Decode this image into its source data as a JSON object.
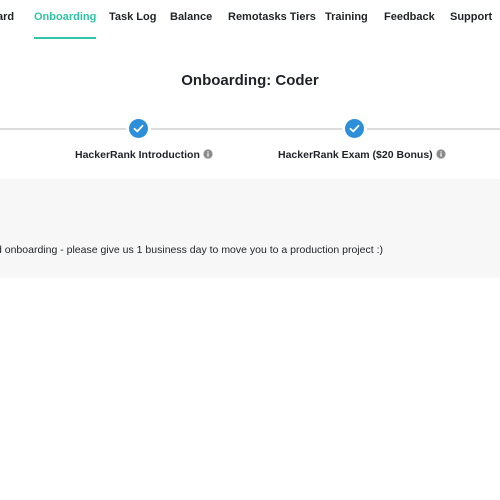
{
  "nav": {
    "items": [
      {
        "label": "ard",
        "active": false
      },
      {
        "label": "Onboarding",
        "active": true
      },
      {
        "label": "Task Log",
        "active": false
      },
      {
        "label": "Balance",
        "active": false
      },
      {
        "label": "Remotasks Tiers",
        "active": false
      },
      {
        "label": "Training",
        "active": false
      },
      {
        "label": "Feedback",
        "active": false
      },
      {
        "label": "Support",
        "active": false
      }
    ]
  },
  "title": "Onboarding: Coder",
  "steps": [
    {
      "label": "HackerRank Introduction",
      "completed": true,
      "icon": "check-icon",
      "info_icon": "info-icon"
    },
    {
      "label": "HackerRank Exam ($20 Bonus)",
      "completed": true,
      "icon": "check-icon",
      "info_icon": "info-icon"
    }
  ],
  "message": "d onboarding - please give us 1 business day to move you to a production project :)",
  "colors": {
    "accent": "#2ec4a4",
    "step_complete": "#2d8fd9",
    "panel_bg": "#f7f7f7",
    "line": "#dcdcdc"
  }
}
